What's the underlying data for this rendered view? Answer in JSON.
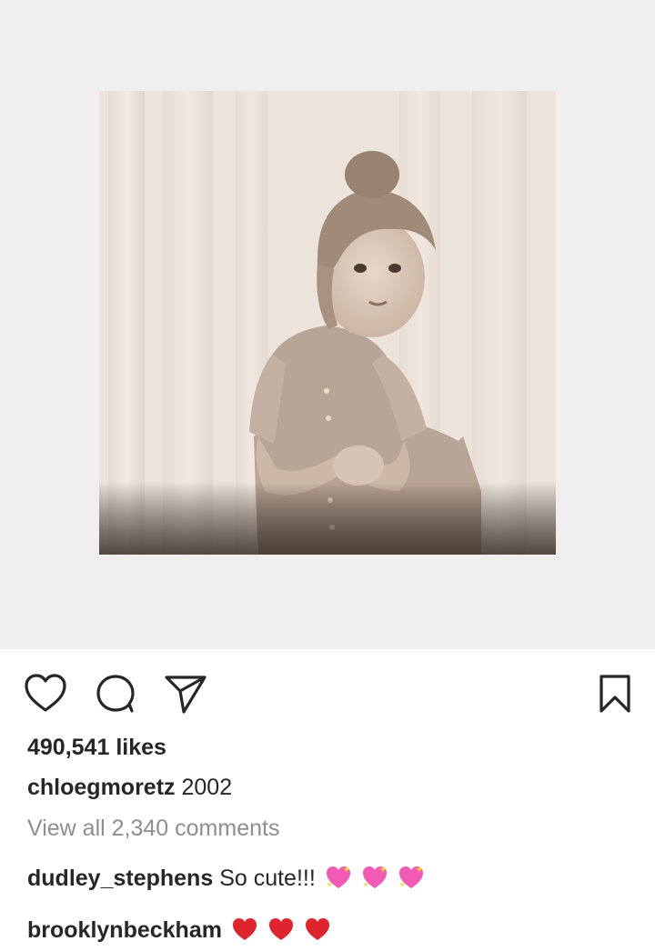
{
  "post": {
    "photo_alt": "Vintage sepia photo",
    "likes": "490,541 likes",
    "caption": {
      "username": "chloegmoretz",
      "text": "2002"
    },
    "view_all_comments": "View all 2,340 comments",
    "comments": [
      {
        "username": "dudley_stephens",
        "text": "So cute!!!",
        "emoji": [
          "sparkling-heart",
          "sparkling-heart",
          "sparkling-heart"
        ]
      },
      {
        "username": "brooklynbeckham",
        "text": "",
        "emoji": [
          "red-heart",
          "red-heart",
          "red-heart"
        ]
      }
    ]
  },
  "icons": {
    "like": "heart-icon",
    "comment": "comment-bubble-icon",
    "share": "paper-plane-icon",
    "save": "bookmark-icon"
  },
  "colors": {
    "text": "#262626",
    "muted": "#8e8e8e",
    "media_background": "#efefef",
    "sparkling_heart": "#f25ab6",
    "red_heart": "#e0242e"
  }
}
